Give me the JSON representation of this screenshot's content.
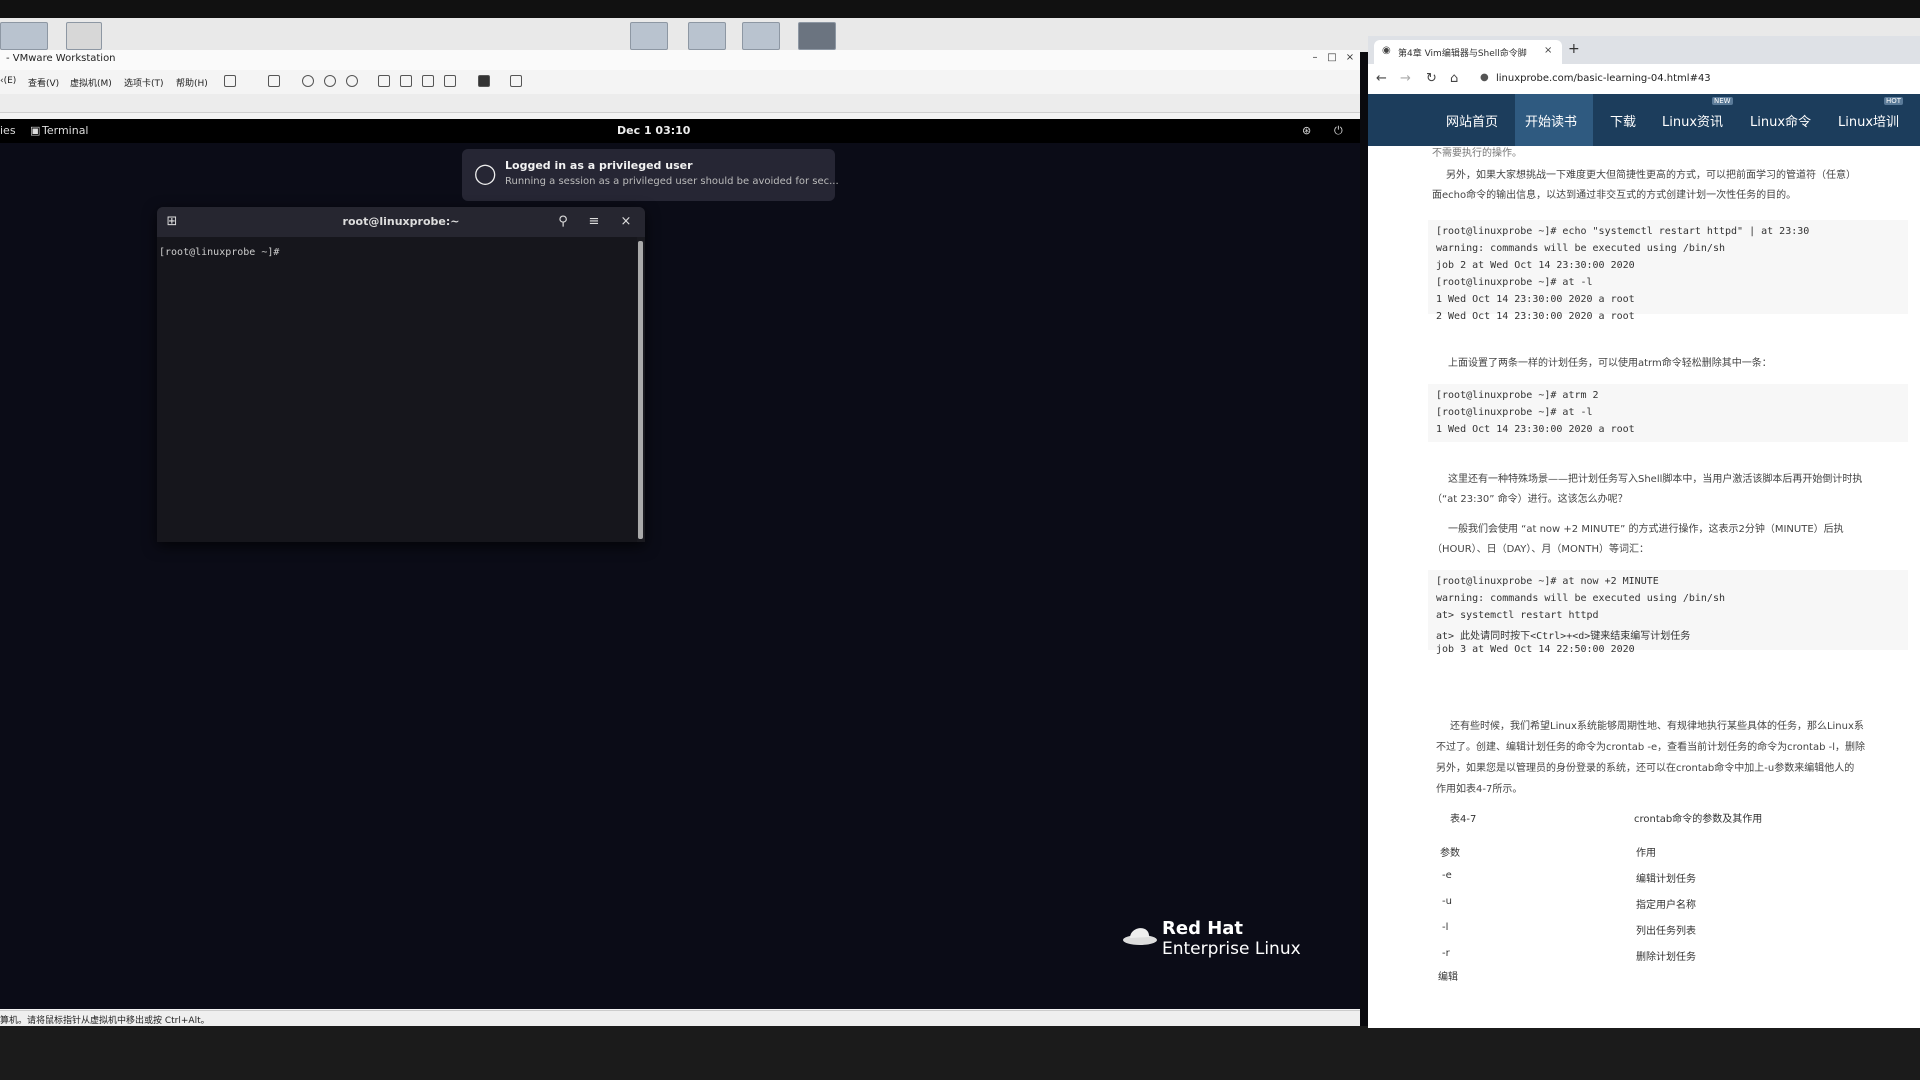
{
  "vmware": {
    "title": "- VMware Workstation",
    "menu": [
      "‹(E)",
      "查看(V)",
      "虚拟机(M)",
      "选项卡(T)",
      "帮助(H)"
    ],
    "status": "算机。请将鼠标指针从虚拟机中移出或按 Ctrl+Alt。"
  },
  "gnome": {
    "activities": "ies",
    "app_name": "Terminal",
    "clock": "Dec 1  03:10"
  },
  "notification": {
    "title": "Logged in as a privileged user",
    "body": "Running a session as a privileged user should be avoided for sec..."
  },
  "terminal": {
    "title": "root@linuxprobe:~",
    "prompt": "[root@linuxprobe ~]#"
  },
  "redhat": {
    "line1": "Red Hat",
    "line2": "Enterprise Linux"
  },
  "browser": {
    "tab_title": "第4章 Vim编辑器与Shell命令脚",
    "url": "linuxprobe.com/basic-learning-04.html#43",
    "nav": [
      "网站首页",
      "开始读书",
      "下载",
      "Linux资讯",
      "Linux命令",
      "Linux培训"
    ],
    "nav_badges": [
      "NEW",
      "HOT"
    ]
  },
  "article": {
    "p0": "不需要执行的操作。",
    "p1a": "另外，如果大家想挑战一下难度更大但简捷性更高的方式，可以把前面学习的管道符（任意）",
    "p1b": "面echo命令的输出信息，以达到通过非交互式的方式创建计划一次性任务的目的。",
    "code1": [
      "[root@linuxprobe ~]# echo \"systemctl restart httpd\" | at 23:30",
      "warning: commands will be executed using /bin/sh",
      "job 2 at Wed Oct 14 23:30:00 2020",
      "[root@linuxprobe ~]# at -l",
      "1 Wed Oct 14 23:30:00 2020 a root",
      "2 Wed Oct 14 23:30:00 2020 a root"
    ],
    "p2": "上面设置了两条一样的计划任务，可以使用atrm命令轻松删除其中一条：",
    "code2": [
      "[root@linuxprobe ~]# atrm 2",
      "[root@linuxprobe ~]# at -l",
      "1 Wed Oct 14 23:30:00 2020 a root"
    ],
    "p3a": "这里还有一种特殊场景——把计划任务写入Shell脚本中，当用户激活该脚本后再开始倒计时执",
    "p3b": "（“at 23:30” 命令）进行。这该怎么办呢？",
    "p4a": "一般我们会使用 “at now +2 MINUTE” 的方式进行操作，这表示2分钟（MINUTE）后执",
    "p4b": "（HOUR）、日（DAY）、月（MONTH）等词汇：",
    "code3": [
      "[root@linuxprobe ~]# at now +2 MINUTE",
      "warning: commands will be executed using /bin/sh",
      "at> systemctl restart httpd",
      "at> 此处请同时按下<Ctrl>+<d>键来结束编写计划任务",
      "job 3 at Wed Oct 14 22:50:00 2020"
    ],
    "p5a": "还有些时候，我们希望Linux系统能够周期性地、有规律地执行某些具体的任务，那么Linux系",
    "p5b": "不过了。创建、编辑计划任务的命令为crontab -e，查看当前计划任务的命令为crontab -l，删除",
    "p5c": "另外，如果您是以管理员的身份登录的系统，还可以在crontab命令中加上-u参数来编辑他人的",
    "p5d": "作用如表4-7所示。",
    "table_caption_left": "表4-7",
    "table_caption_right": "crontab命令的参数及其作用",
    "table_headers": [
      "参数",
      "作用"
    ],
    "table_rows": [
      [
        "-e",
        "编辑计划任务"
      ],
      [
        "-u",
        "指定用户名称"
      ],
      [
        "-l",
        "列出任务列表"
      ],
      [
        "-r",
        "删除计划任务"
      ]
    ],
    "edit_label": "编辑"
  }
}
